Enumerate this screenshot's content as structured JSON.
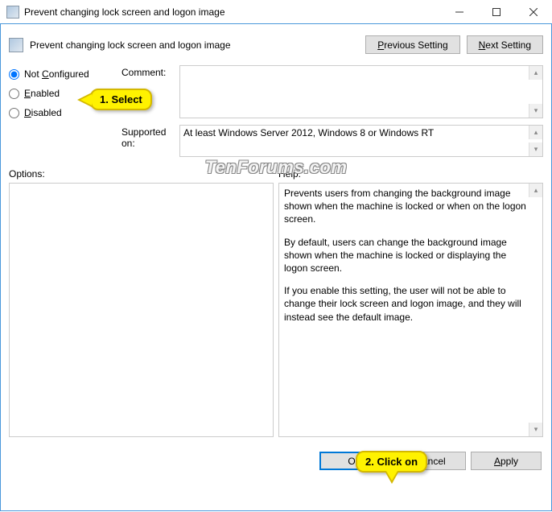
{
  "window": {
    "title": "Prevent changing lock screen and logon image"
  },
  "header": {
    "title": "Prevent changing lock screen and logon image",
    "prev_btn": "Previous Setting",
    "next_btn": "Next Setting"
  },
  "radios": {
    "not_configured": "Not Configured",
    "enabled": "Enabled",
    "disabled": "Disabled"
  },
  "labels": {
    "comment": "Comment:",
    "supported": "Supported on:",
    "options": "Options:",
    "help": "Help:"
  },
  "fields": {
    "comment": "",
    "supported": "At least Windows Server 2012, Windows 8 or Windows RT"
  },
  "help": {
    "p1": "Prevents users from changing the background image shown when the machine is locked or when on the logon screen.",
    "p2": "By default, users can change the background image shown when the machine is locked or displaying the logon screen.",
    "p3": "If you enable this setting, the user will not be able to change their lock screen and logon image, and they will instead see the default image."
  },
  "footer": {
    "ok": "OK",
    "cancel": "Cancel",
    "apply": "Apply"
  },
  "callouts": {
    "select": "1. Select",
    "click": "2. Click on"
  },
  "watermark": "TenForums.com"
}
